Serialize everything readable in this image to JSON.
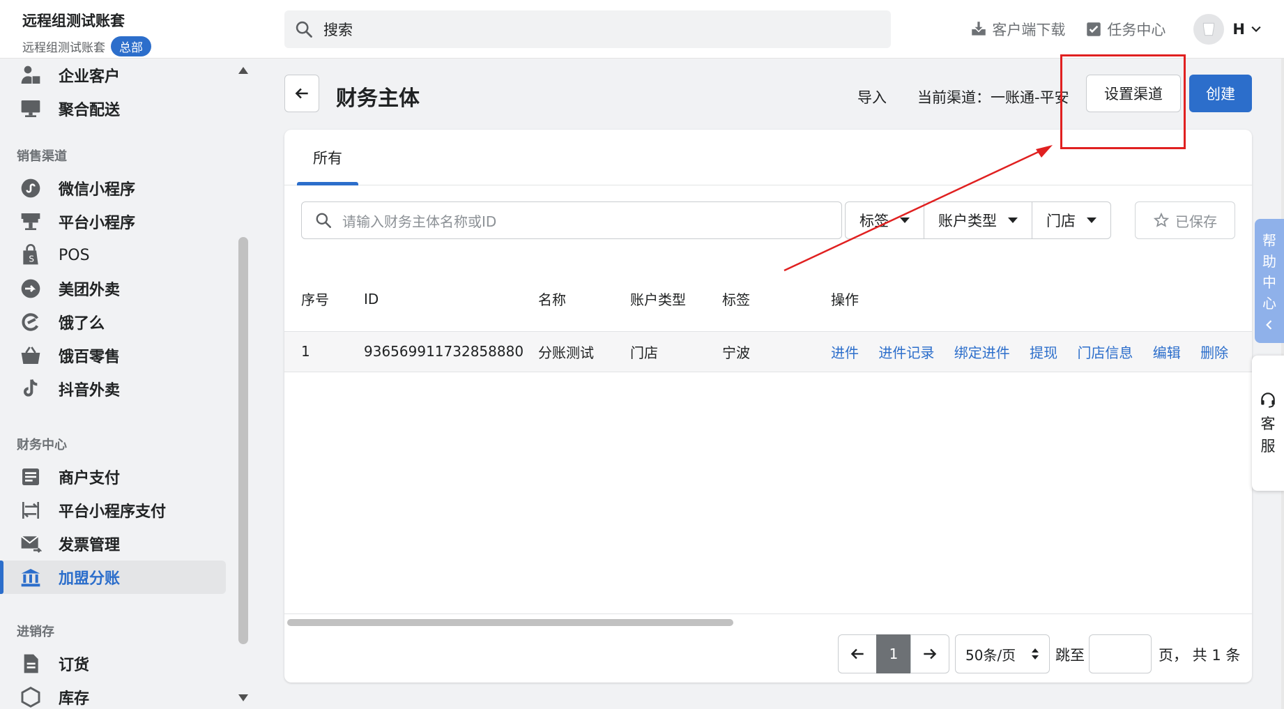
{
  "header": {
    "brand_title": "远程组测试账套",
    "brand_sub": "远程组测试账套",
    "brand_badge": "总部",
    "search_placeholder": "搜索",
    "download": "客户端下载",
    "tasks": "任务中心",
    "user_initial": "H"
  },
  "sidebar": {
    "top_items": [
      {
        "label": "企业客户",
        "icon": "user-building-icon"
      },
      {
        "label": "聚合配送",
        "icon": "monitor-icon"
      }
    ],
    "sections": [
      {
        "title": "销售渠道",
        "items": [
          {
            "label": "微信小程序",
            "icon": "mini-program-icon"
          },
          {
            "label": "平台小程序",
            "icon": "store-icon"
          },
          {
            "label": "POS",
            "icon": "pos-bag-icon"
          },
          {
            "label": "美团外卖",
            "icon": "meituan-icon"
          },
          {
            "label": "饿了么",
            "icon": "eleme-icon"
          },
          {
            "label": "饿百零售",
            "icon": "basket-icon"
          },
          {
            "label": "抖音外卖",
            "icon": "tiktok-icon"
          }
        ]
      },
      {
        "title": "财务中心",
        "items": [
          {
            "label": "商户支付",
            "icon": "list-icon"
          },
          {
            "label": "平台小程序支付",
            "icon": "transfer-icon"
          },
          {
            "label": "发票管理",
            "icon": "mail-icon"
          },
          {
            "label": "加盟分账",
            "icon": "bank-icon",
            "active": true
          }
        ]
      },
      {
        "title": "进销存",
        "items": [
          {
            "label": "订货",
            "icon": "document-icon"
          },
          {
            "label": "库存",
            "icon": "box-icon"
          }
        ]
      }
    ]
  },
  "page": {
    "title": "财务主体",
    "import_label": "导入",
    "channel_text": "当前渠道：一账通-平安",
    "set_channel_label": "设置渠道",
    "create_label": "创建"
  },
  "tabs": [
    {
      "label": "所有",
      "active": true
    }
  ],
  "filters": {
    "search_placeholder": "请输入财务主体名称或ID",
    "tag": "标签",
    "account_type": "账户类型",
    "store": "门店",
    "saved": "已保存"
  },
  "table": {
    "headers": [
      "序号",
      "ID",
      "名称",
      "账户类型",
      "标签",
      "操作"
    ],
    "rows": [
      {
        "index": "1",
        "id": "936569911732858880",
        "name": "分账测试",
        "account_type": "门店",
        "tag": "宁波",
        "actions": [
          "进件",
          "进件记录",
          "绑定进件",
          "提现",
          "门店信息",
          "编辑",
          "删除"
        ]
      }
    ]
  },
  "pagination": {
    "current_page": "1",
    "page_size": "50条/页",
    "jump_label": "跳至",
    "total_text": "页， 共 1 条"
  },
  "widgets": {
    "help_chars": [
      "帮",
      "助",
      "中",
      "心"
    ],
    "service_chars": [
      "客",
      "服"
    ]
  },
  "colors": {
    "accent": "#2c6ecb",
    "annotation": "#e02020"
  }
}
